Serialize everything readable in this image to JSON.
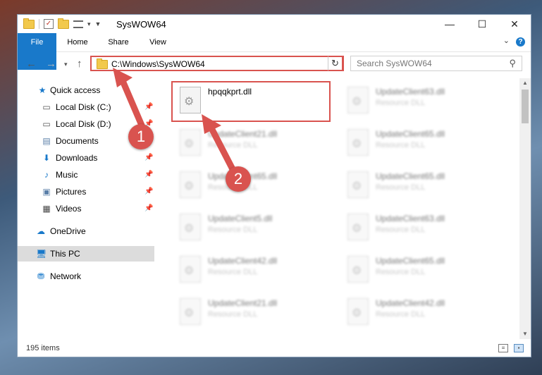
{
  "window": {
    "title": "SysWOW64"
  },
  "ribbon": {
    "file_label": "File",
    "home_label": "Home",
    "share_label": "Share",
    "view_label": "View"
  },
  "address": {
    "path": "C:\\Windows\\SysWOW64",
    "search_placeholder": "Search SysWOW64"
  },
  "sidebar": {
    "items": [
      {
        "label": "Quick access",
        "icon": "star-icon"
      },
      {
        "label": "Local Disk (C:)",
        "icon": "drive-icon"
      },
      {
        "label": "Local Disk (D:)",
        "icon": "drive-icon"
      },
      {
        "label": "Documents",
        "icon": "documents-icon"
      },
      {
        "label": "Downloads",
        "icon": "downloads-icon"
      },
      {
        "label": "Music",
        "icon": "music-icon"
      },
      {
        "label": "Pictures",
        "icon": "pictures-icon"
      },
      {
        "label": "Videos",
        "icon": "videos-icon"
      },
      {
        "label": "OneDrive",
        "icon": "cloud-icon"
      },
      {
        "label": "This PC",
        "icon": "computer-icon"
      },
      {
        "label": "Network",
        "icon": "network-icon"
      }
    ]
  },
  "files": [
    {
      "name": "hpqqkprt.dll",
      "type": ""
    },
    {
      "name": "UpdateClient63.dll",
      "type": "Resource DLL"
    },
    {
      "name": "UpdateClient21.dll",
      "type": "Resource DLL"
    },
    {
      "name": "UpdateClient65.dll",
      "type": "Resource DLL"
    },
    {
      "name": "UpdateClient65.dll",
      "type": "Resource DLL"
    },
    {
      "name": "UpdateClient65.dll",
      "type": "Resource DLL"
    },
    {
      "name": "UpdateClient5.dll",
      "type": "Resource DLL"
    },
    {
      "name": "UpdateClient63.dll",
      "type": "Resource DLL"
    },
    {
      "name": "UpdateClient42.dll",
      "type": "Resource DLL"
    },
    {
      "name": "UpdateClient65.dll",
      "type": "Resource DLL"
    },
    {
      "name": "UpdateClient21.dll",
      "type": "Resource DLL"
    },
    {
      "name": "UpdateClient42.dll",
      "type": "Resource DLL"
    }
  ],
  "status": {
    "item_count": "195 items"
  },
  "callouts": {
    "one": "1",
    "two": "2"
  },
  "colors": {
    "accent": "#1979ca",
    "highlight": "#d9534f"
  }
}
